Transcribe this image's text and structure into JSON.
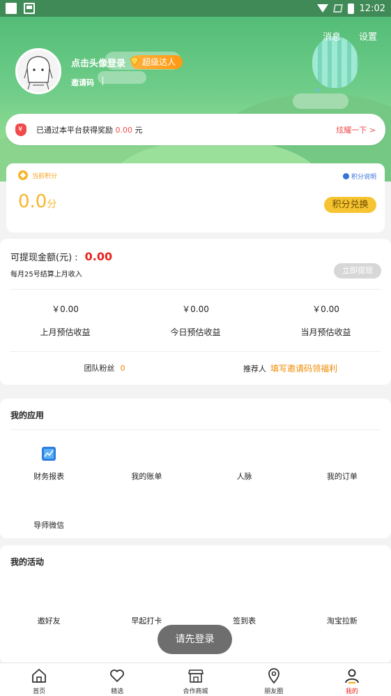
{
  "status_bar": {
    "time": "12:02"
  },
  "header": {
    "messages_label": "消息",
    "settings_label": "设置",
    "login_prompt": "点击头像登录",
    "vip_label": "超级达人",
    "invite_code_label": "邀请码"
  },
  "reward_banner": {
    "prefix": "已通过本平台获得奖励",
    "amount": "0.00",
    "suffix": "元",
    "link_label": "炫耀一下 >"
  },
  "points": {
    "label": "当前积分",
    "explain_label": "积分说明",
    "value": "0.0",
    "unit": "分",
    "exchange_label": "积分兑换"
  },
  "earnings": {
    "withdrawable_label": "可提现金额(元) :",
    "withdrawable_amount": "0.00",
    "settle_note": "每月25号结算上月收入",
    "withdraw_button": "立即提现",
    "stats": [
      {
        "value": "￥0.00",
        "label": "上月预估收益"
      },
      {
        "value": "￥0.00",
        "label": "今日预估收益"
      },
      {
        "value": "￥0.00",
        "label": "当月预估收益"
      }
    ],
    "team_fans_label": "团队粉丝",
    "team_fans_count": "0",
    "referrer_label": "推荐人",
    "referrer_link": "填写邀请码领福利"
  },
  "my_apps": {
    "title": "我的应用",
    "items": [
      {
        "label": "财务报表",
        "icon": "report-chart-icon"
      },
      {
        "label": "我的账单"
      },
      {
        "label": "人脉"
      },
      {
        "label": "我的订单"
      },
      {
        "label": "导师微信"
      }
    ]
  },
  "my_activities": {
    "title": "我的活动",
    "items": [
      {
        "label": "邀好友"
      },
      {
        "label": "早起打卡"
      },
      {
        "label": "签到表"
      },
      {
        "label": "淘宝拉新"
      }
    ]
  },
  "toast": "请先登录",
  "tabbar": {
    "items": [
      {
        "label": "首页",
        "icon": "home-icon"
      },
      {
        "label": "精选",
        "icon": "heart-icon"
      },
      {
        "label": "合作商城",
        "icon": "store-icon"
      },
      {
        "label": "朋友圈",
        "icon": "location-pin-icon"
      },
      {
        "label": "我的",
        "icon": "person-icon",
        "active": true
      }
    ]
  },
  "colors": {
    "accent_red": "#e8231e",
    "brand_green": "#53bd77",
    "gold": "#f6b62a",
    "orange": "#f08a00"
  }
}
